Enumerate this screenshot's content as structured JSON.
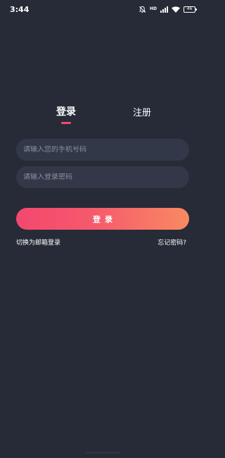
{
  "status_bar": {
    "time": "3:44",
    "network_label": "HD",
    "battery_level": "46",
    "icons": [
      "mute-bell-icon",
      "signal-icon",
      "wifi-icon",
      "battery-icon"
    ]
  },
  "tabs": [
    {
      "label": "登录",
      "active": true
    },
    {
      "label": "注册",
      "active": false
    }
  ],
  "form": {
    "phone_placeholder": "请输入您的手机号码",
    "phone_value": "",
    "password_placeholder": "请输入登录密码",
    "password_value": ""
  },
  "login_button_label": "登录",
  "links": {
    "switch_to_email": "切换为邮箱登录",
    "forgot_password": "忘记密码?"
  },
  "colors": {
    "background": "#262b37",
    "input_background": "#333849",
    "accent_start": "#f4476e",
    "accent_end": "#f98a62",
    "placeholder": "#8a8f9c"
  }
}
